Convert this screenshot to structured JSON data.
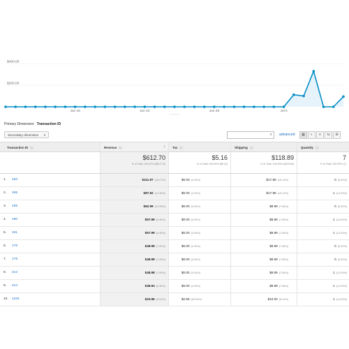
{
  "chart_data": {
    "type": "area",
    "x": [
      "Jun 8",
      "Jun 9",
      "Jun 10",
      "Jun 11",
      "Jun 12",
      "Jun 13",
      "Jun 14",
      "Jun 15",
      "Jun 16",
      "Jun 17",
      "Jun 18",
      "Jun 19",
      "Jun 20",
      "Jun 21",
      "Jun 22",
      "Jun 23",
      "Jun 24",
      "Jun 25",
      "Jun 26",
      "Jun 27",
      "Jun 28",
      "Jun 29",
      "Jun 30",
      "Jul 1",
      "Jul 2",
      "Jul 3",
      "Jul 4",
      "Jul 5",
      "Jul 6",
      "Jul 7",
      "Jul 8",
      "Jul 9",
      "Jul 10",
      "Jul 11"
    ],
    "series": [
      {
        "values": [
          0,
          0,
          0,
          0,
          0,
          0,
          0,
          0,
          0,
          0,
          0,
          0,
          0,
          0,
          0,
          0,
          0,
          0,
          0,
          0,
          0,
          0,
          0,
          0,
          0,
          0,
          0,
          0,
          0,
          112,
          100,
          330,
          0,
          0,
          95
        ]
      }
    ],
    "ylim": [
      0,
      440
    ],
    "ytick_labels": [
      "$200.00",
      "$400.00"
    ],
    "xtick_labels": [
      "Jun 15",
      "Jun 22",
      "Jun 29",
      "Jul 6"
    ],
    "line_color": "#058dc7",
    "fill_color": "#e6f3fa"
  },
  "primary_dimension": {
    "label": "Primary Dimension:",
    "value": "Transaction ID"
  },
  "toolbar": {
    "secondary_dimension": "Secondary dimension",
    "search_placeholder": "",
    "advanced": "advanced"
  },
  "table": {
    "headers": {
      "transaction_id": "Transaction ID",
      "revenue": "Revenue",
      "tax": "Tax",
      "shipping": "Shipping",
      "quantity": "Quantity"
    },
    "totals": {
      "revenue": "$612.70",
      "revenue_sub": "% of Total: 100.00% ($612.70)",
      "tax": "$5.16",
      "tax_sub": "% of Total: 100.00% ($5.16)",
      "shipping": "$118.89",
      "shipping_sub": "% of Total: 100.00% ($118.89)",
      "quantity": "7",
      "quantity_sub": "% of Total: 100.00% (7)"
    },
    "rows": [
      {
        "idx": "1.",
        "id": "183",
        "revenue": "$111.97",
        "revenue_pct": "(18.27%)",
        "tax": "$0.00",
        "tax_pct": "(0.00%)",
        "shipping": "$17.98",
        "shipping_pct": "(15.12%)",
        "qty": "0",
        "qty_pct": "(0.00%)"
      },
      {
        "idx": "2.",
        "id": "195",
        "revenue": "$87.92",
        "revenue_pct": "(14.35%)",
        "tax": "$0.00",
        "tax_pct": "(0.00%)",
        "shipping": "$17.98",
        "shipping_pct": "(15.12%)",
        "qty": "1",
        "qty_pct": "(14.29%)"
      },
      {
        "idx": "3.",
        "id": "169",
        "revenue": "$62.99",
        "revenue_pct": "(10.28%)",
        "tax": "$0.00",
        "tax_pct": "(0.00%)",
        "shipping": "$8.99",
        "shipping_pct": "(7.56%)",
        "qty": "0",
        "qty_pct": "(0.00%)"
      },
      {
        "idx": "4.",
        "id": "190",
        "revenue": "$57.99",
        "revenue_pct": "(9.46%)",
        "tax": "$0.00",
        "tax_pct": "(0.00%)",
        "shipping": "$8.99",
        "shipping_pct": "(7.56%)",
        "qty": "1",
        "qty_pct": "(14.29%)"
      },
      {
        "idx": "5.",
        "id": "191",
        "revenue": "$57.99",
        "revenue_pct": "(9.46%)",
        "tax": "$0.00",
        "tax_pct": "(0.00%)",
        "shipping": "$8.99",
        "shipping_pct": "(7.56%)",
        "qty": "1",
        "qty_pct": "(14.29%)"
      },
      {
        "idx": "6.",
        "id": "178",
        "revenue": "$48.98",
        "revenue_pct": "(7.99%)",
        "tax": "$0.00",
        "tax_pct": "(0.00%)",
        "shipping": "$8.99",
        "shipping_pct": "(7.56%)",
        "qty": "0",
        "qty_pct": "(0.00%)"
      },
      {
        "idx": "7.",
        "id": "179",
        "revenue": "$48.98",
        "revenue_pct": "(7.99%)",
        "tax": "$0.00",
        "tax_pct": "(0.00%)",
        "shipping": "$8.99",
        "shipping_pct": "(7.56%)",
        "qty": "0",
        "qty_pct": "(0.00%)"
      },
      {
        "idx": "8.",
        "id": "212",
        "revenue": "$48.98",
        "revenue_pct": "(7.99%)",
        "tax": "$0.00",
        "tax_pct": "(0.00%)",
        "shipping": "$8.99",
        "shipping_pct": "(7.56%)",
        "qty": "1",
        "qty_pct": "(14.29%)"
      },
      {
        "idx": "9.",
        "id": "214",
        "revenue": "$38.94",
        "revenue_pct": "(6.36%)",
        "tax": "$0.00",
        "tax_pct": "(0.00%)",
        "shipping": "$8.99",
        "shipping_pct": "(7.56%)",
        "qty": "1",
        "qty_pct": "(14.29%)"
      },
      {
        "idx": "10.",
        "id": "1234",
        "revenue": "$23.96",
        "revenue_pct": "(3.91%)",
        "tax": "$2.58",
        "tax_pct": "(50.00%)",
        "shipping": "$10.00",
        "shipping_pct": "(8.41%)",
        "qty": "1",
        "qty_pct": "(14.29%)"
      }
    ]
  }
}
